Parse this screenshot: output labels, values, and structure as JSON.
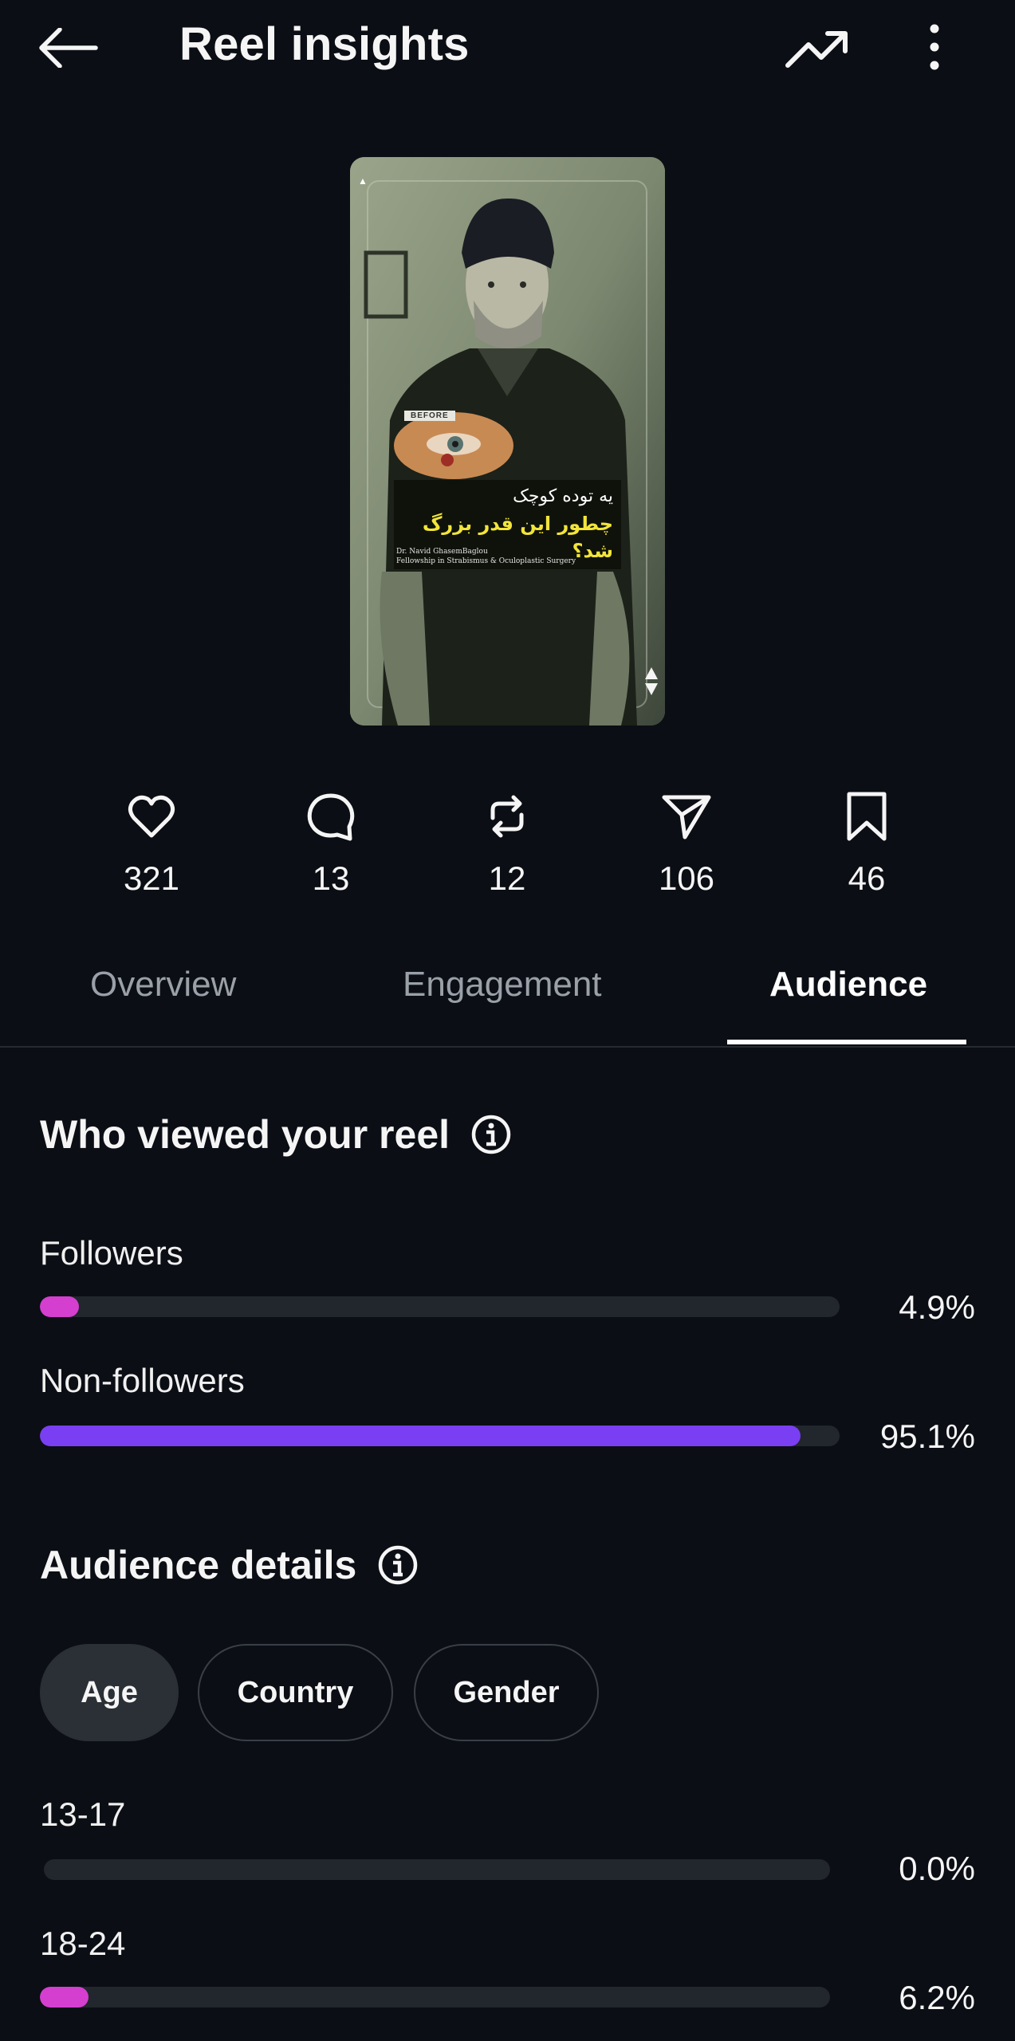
{
  "header": {
    "title": "Reel insights",
    "back_icon": "arrow-left-icon",
    "trend_icon": "trending-up-icon",
    "more_icon": "more-vertical-icon"
  },
  "reel": {
    "before_tag": "BEFORE",
    "caption_line1": "یه توده کوچک",
    "caption_line2": "چطور این قدر بزرگ شد؟",
    "credit_line1": "Dr. Navid GhasemBaglou",
    "credit_line2": "Fellowship in Strabismus & Oculoplastic Surgery"
  },
  "stats": [
    {
      "icon": "heart-icon",
      "count": "321"
    },
    {
      "icon": "comment-icon",
      "count": "13"
    },
    {
      "icon": "repost-icon",
      "count": "12"
    },
    {
      "icon": "share-icon",
      "count": "106"
    },
    {
      "icon": "bookmark-icon",
      "count": "46"
    }
  ],
  "tabs": [
    {
      "label": "Overview",
      "active": false
    },
    {
      "label": "Engagement",
      "active": false
    },
    {
      "label": "Audience",
      "active": true
    }
  ],
  "viewers": {
    "title": "Who viewed your reel",
    "rows": [
      {
        "label": "Followers",
        "value": "4.9%",
        "fraction": 0.049,
        "color": "#d43fcf"
      },
      {
        "label": "Non-followers",
        "value": "95.1%",
        "fraction": 0.951,
        "color": "#7a3ff2"
      }
    ]
  },
  "audience": {
    "title": "Audience details",
    "chips": [
      {
        "label": "Age",
        "active": true
      },
      {
        "label": "Country",
        "active": false
      },
      {
        "label": "Gender",
        "active": false
      }
    ],
    "rows": [
      {
        "label": "13-17",
        "value": "0.0%",
        "fraction": 0.0,
        "color": "#d43fcf"
      },
      {
        "label": "18-24",
        "value": "6.2%",
        "fraction": 0.062,
        "color": "#d43fcf"
      }
    ]
  },
  "colors": {
    "background": "#0b0e14",
    "track": "#22262d",
    "magenta": "#d43fcf",
    "purple": "#7a3ff2"
  }
}
